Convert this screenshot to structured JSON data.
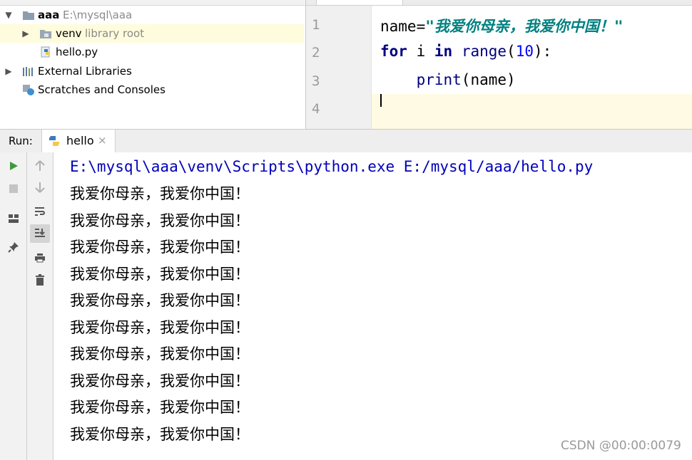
{
  "project_tree": {
    "root": {
      "name": "aaa",
      "path": "E:\\mysql\\aaa"
    },
    "venv": {
      "name": "venv",
      "hint": "library root"
    },
    "file": {
      "name": "hello.py"
    },
    "external_libraries": "External Libraries",
    "scratches": "Scratches and Consoles"
  },
  "editor": {
    "lines": [
      {
        "num": "1",
        "name_part": "name",
        "eq": "=",
        "str_part": "\"我爱你母亲，我爱你中国！\""
      },
      {
        "num": "2",
        "kw_for": "for",
        "var": " i ",
        "kw_in": "in",
        "sp": " ",
        "fn": "range",
        "paren_open": "(",
        "arg": "10",
        "paren_close": "):"
      },
      {
        "num": "3",
        "indent": "    ",
        "fn": "print",
        "args": "(name)"
      },
      {
        "num": "4"
      }
    ]
  },
  "run_panel": {
    "label": "Run:",
    "tab_label": "hello",
    "close_glyph": "×"
  },
  "console": {
    "command": "E:\\mysql\\aaa\\venv\\Scripts\\python.exe E:/mysql/aaa/hello.py",
    "output": [
      "我爱你母亲，我爱你中国！",
      "我爱你母亲，我爱你中国！",
      "我爱你母亲，我爱你中国！",
      "我爱你母亲，我爱你中国！",
      "我爱你母亲，我爱你中国！",
      "我爱你母亲，我爱你中国！",
      "我爱你母亲，我爱你中国！",
      "我爱你母亲，我爱你中国！",
      "我爱你母亲，我爱你中国！",
      "我爱你母亲，我爱你中国！"
    ]
  },
  "watermark": "CSDN @00:00:0079",
  "colors": {
    "selection": "#fefcdc",
    "keyword": "#000080",
    "string": "#008080",
    "number": "#0000ff",
    "command": "#0000ba",
    "run_green": "#3c9a3c"
  }
}
